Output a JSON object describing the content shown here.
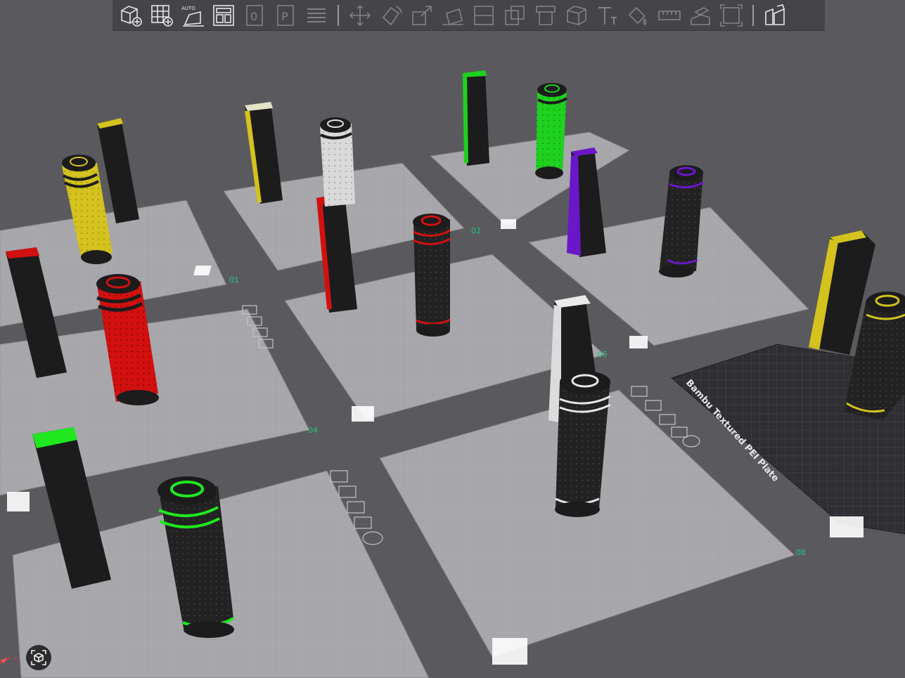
{
  "toolbar": {
    "buttons": [
      {
        "name": "add-object-icon",
        "enabled": true
      },
      {
        "name": "add-plate-icon",
        "enabled": true
      },
      {
        "name": "auto-orient-icon",
        "enabled": true,
        "label": "AUTO"
      },
      {
        "name": "arrange-icon",
        "enabled": true
      },
      {
        "name": "slice-plate-icon",
        "enabled": false
      },
      {
        "name": "print-plate-icon",
        "enabled": false
      },
      {
        "name": "layers-icon",
        "enabled": false
      },
      {
        "name": "move-icon",
        "enabled": false
      },
      {
        "name": "rotate-icon",
        "enabled": false
      },
      {
        "name": "scale-icon",
        "enabled": false
      },
      {
        "name": "lay-on-face-icon",
        "enabled": false
      },
      {
        "name": "cut-icon",
        "enabled": false
      },
      {
        "name": "boolean-icon",
        "enabled": false
      },
      {
        "name": "support-paint-icon",
        "enabled": false
      },
      {
        "name": "seam-paint-icon",
        "enabled": false
      },
      {
        "name": "text-icon",
        "enabled": false
      },
      {
        "name": "color-paint-icon",
        "enabled": false
      },
      {
        "name": "measure-icon",
        "enabled": false
      },
      {
        "name": "assembly-icon",
        "enabled": false
      },
      {
        "name": "fit-view-icon",
        "enabled": false
      },
      {
        "name": "split-objects-icon",
        "enabled": true
      }
    ]
  },
  "plates": {
    "labels": [
      "01",
      "02",
      "04",
      "05",
      "08"
    ],
    "selected_plate_name": "Bambu Textured PEI Plate"
  },
  "grip_colors": {
    "yellow": "#d4c21e",
    "white": "#d9d9d9",
    "green": "#1fd11f",
    "purple": "#6a17c9",
    "red": "#d21010",
    "black": "#1c1c1c"
  },
  "bottom": {
    "view_button_icon": "view-cube-icon",
    "axis_label": "x"
  }
}
